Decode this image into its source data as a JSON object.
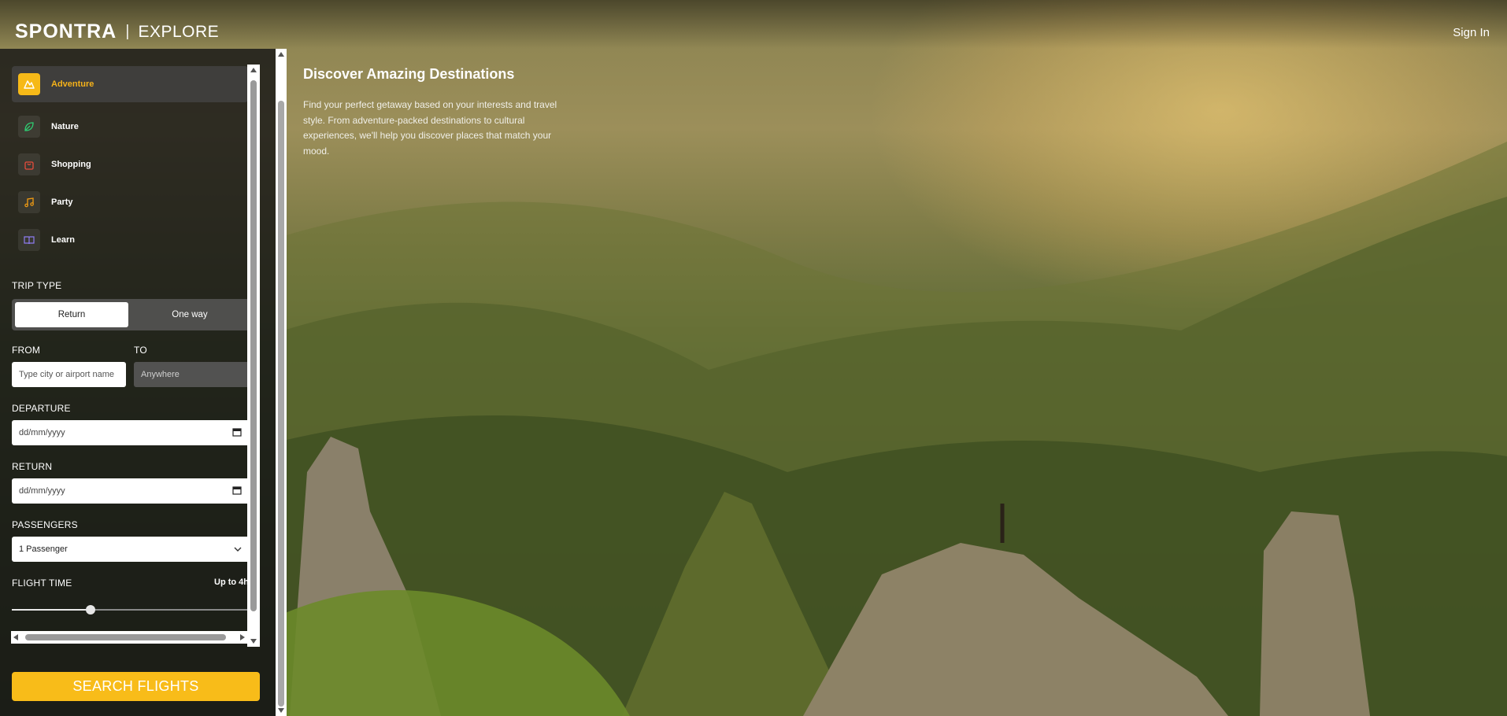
{
  "header": {
    "brand": "SPONTRA",
    "separator": "|",
    "section": "EXPLORE",
    "sign_in": "Sign In"
  },
  "categories": [
    {
      "label": "Adventure",
      "icon": "mountain-icon",
      "color": "#f6b918",
      "active": true
    },
    {
      "label": "Nature",
      "icon": "leaf-icon",
      "color": "#2ecc71",
      "active": false
    },
    {
      "label": "Shopping",
      "icon": "shopping-bag-icon",
      "color": "#e74c3c",
      "active": false
    },
    {
      "label": "Party",
      "icon": "music-note-icon",
      "color": "#f39c12",
      "active": false
    },
    {
      "label": "Learn",
      "icon": "book-icon",
      "color": "#8e7cf0",
      "active": false
    }
  ],
  "form": {
    "trip_type_label": "TRIP TYPE",
    "trip_options": [
      "Return",
      "One way"
    ],
    "trip_selected": "Return",
    "from_label": "FROM",
    "to_label": "TO",
    "from_placeholder": "Type city or airport name",
    "to_placeholder": "Anywhere",
    "departure_label": "DEPARTURE",
    "departure_value": "dd/mm/yyyy",
    "return_label": "RETURN",
    "return_value": "dd/mm/yyyy",
    "passengers_label": "PASSENGERS",
    "passengers_value": "1 Passenger",
    "flight_time_label": "FLIGHT TIME",
    "flight_time_value": "Up to 4h",
    "flight_time_fraction": 0.33,
    "search_button": "SEARCH FLIGHTS"
  },
  "hero": {
    "title": "Discover Amazing Destinations",
    "body": "Find your perfect getaway based on your interests and travel style. From adventure-packed destinations to cultural experiences, we'll help you discover places that match your mood."
  },
  "colors": {
    "accent": "#f8bc19",
    "sidebar_bg": "#161616"
  }
}
